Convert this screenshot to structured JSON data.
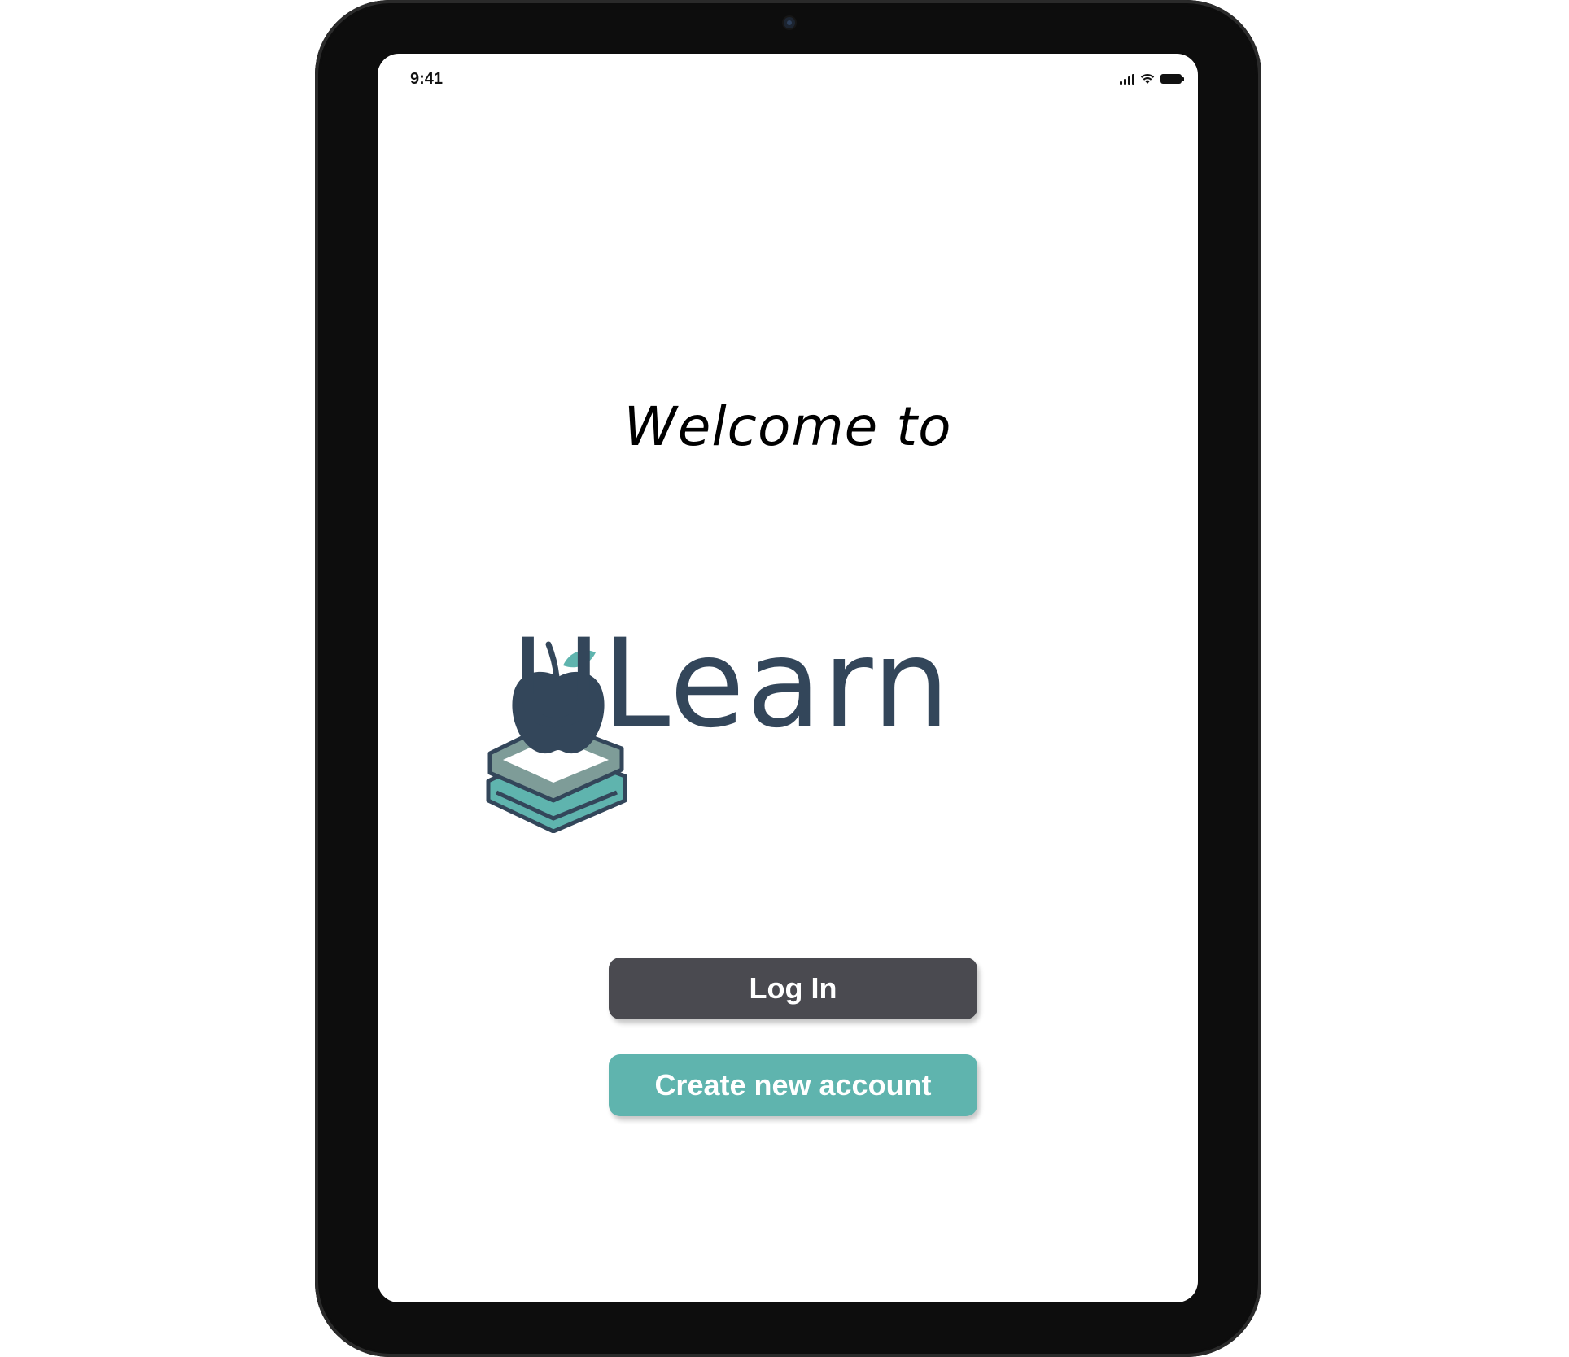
{
  "status_bar": {
    "time": "9:41",
    "icons": [
      "cellular-signal-icon",
      "wifi-icon",
      "battery-icon"
    ]
  },
  "welcome": {
    "heading": "Welcome to",
    "logo_text": "ULearn",
    "logo_icon": "apple-on-books-icon"
  },
  "actions": {
    "login_label": "Log In",
    "create_account_label": "Create new account"
  },
  "colors": {
    "logo_navy": "#33465a",
    "brand_teal": "#5fb4ae",
    "login_button": "#4a4a50",
    "device_bezel": "#0d0d0d"
  }
}
